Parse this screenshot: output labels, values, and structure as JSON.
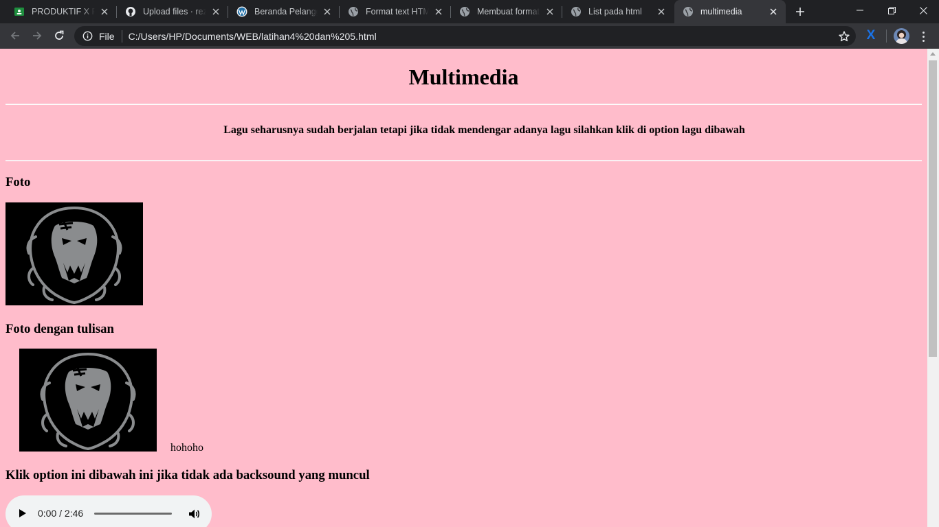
{
  "browser": {
    "tabs": [
      {
        "title": "PRODUKTIF X RPL",
        "icon": "classroom-icon",
        "active": false
      },
      {
        "title": "Upload files · rezaa",
        "icon": "github-icon",
        "active": false
      },
      {
        "title": "Beranda Pelanggan",
        "icon": "wordpress-icon",
        "active": false
      },
      {
        "title": "Format text HTML",
        "icon": "globe-icon",
        "active": false
      },
      {
        "title": "Membuat format t",
        "icon": "globe-icon",
        "active": false
      },
      {
        "title": "List pada html",
        "icon": "globe-icon",
        "active": false
      },
      {
        "title": "multimedia",
        "icon": "globe-icon",
        "active": true
      }
    ],
    "address": {
      "scheme_label": "File",
      "url": "C:/Users/HP/Documents/WEB/latihan4%20dan%205.html"
    },
    "extension_label": "X"
  },
  "page": {
    "title": "Multimedia",
    "notice": "Lagu seharusnya sudah berjalan tetapi jika tidak mendengar adanya lagu silahkan klik di option lagu dibawah",
    "section_foto": "Foto",
    "section_foto_tulisan": "Foto dengan tulisan",
    "image_caption": "hohoho",
    "section_klik": "Klik option ini dibawah ini jika tidak ada backsound yang muncul",
    "audio": {
      "time": "0:00 / 2:46",
      "progress": 0
    }
  },
  "colors": {
    "page_background": "#ffbccb",
    "tabstrip": "#202124",
    "toolbar": "#35363a"
  }
}
